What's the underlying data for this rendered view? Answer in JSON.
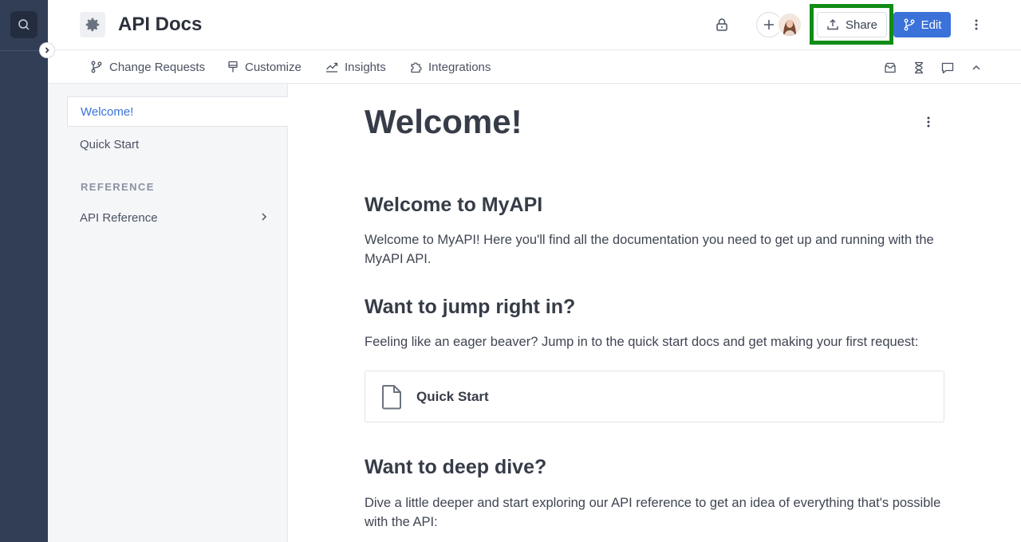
{
  "header": {
    "title": "API Docs",
    "share_label": "Share",
    "edit_label": "Edit",
    "accent_color": "#3a72d9",
    "highlight_color": "#118c16"
  },
  "subnav": {
    "items": [
      {
        "label": "Change Requests",
        "icon": "branch-icon"
      },
      {
        "label": "Customize",
        "icon": "brush-icon"
      },
      {
        "label": "Insights",
        "icon": "chart-icon"
      },
      {
        "label": "Integrations",
        "icon": "puzzle-icon"
      }
    ],
    "right_icons": [
      "inbox-icon",
      "hourglass-icon",
      "comment-icon",
      "chevron-up-icon"
    ]
  },
  "sidebar": {
    "items": [
      {
        "label": "Welcome!",
        "active": true
      },
      {
        "label": "Quick Start",
        "active": false
      }
    ],
    "section_title": "REFERENCE",
    "section_items": [
      {
        "label": "API Reference"
      }
    ]
  },
  "content": {
    "title": "Welcome!",
    "sections": [
      {
        "heading": "Welcome to MyAPI",
        "text": "Welcome to MyAPI! Here you'll find all the documentation you need to get up and running with the MyAPI API."
      },
      {
        "heading": "Want to jump right in?",
        "text": "Feeling like an eager beaver? Jump in to the quick start docs and get making your first request:"
      },
      {
        "heading": "Want to deep dive?",
        "text": "Dive a little deeper and start exploring our API reference to get an idea of everything that's possible with the API:"
      }
    ],
    "card": {
      "label": "Quick Start",
      "icon": "document-icon"
    }
  }
}
